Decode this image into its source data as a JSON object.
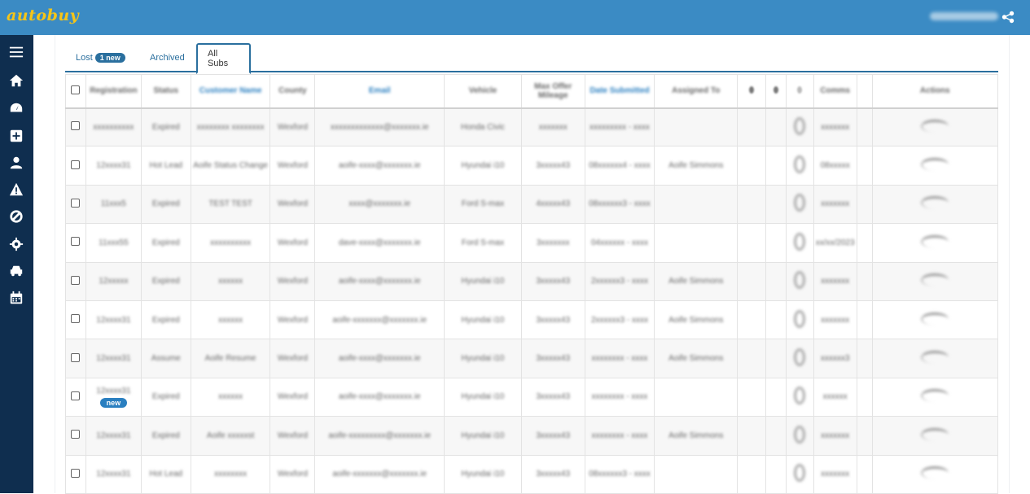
{
  "brand": {
    "logo": "autobuy",
    "user_name": "xxxxxxxxxxxxxx"
  },
  "sidebar": {
    "icons": [
      "menu-icon",
      "home-icon",
      "dashboard-icon",
      "plus-square-icon",
      "user-icon",
      "warning-icon",
      "ban-icon",
      "gear-icon",
      "car-icon",
      "calendar-icon"
    ]
  },
  "tabs": [
    {
      "label": "Lost",
      "badge": "1 new"
    },
    {
      "label": "Archived"
    },
    {
      "label": "All Subs"
    }
  ],
  "table": {
    "headers": [
      "Registration",
      "Status",
      "Customer Name",
      "County",
      "Email",
      "Vehicle",
      "Max Offer Mileage",
      "Date Submitted",
      "Assigned To",
      "",
      "",
      "",
      "Comms",
      "",
      "Actions"
    ],
    "rows": [
      {
        "reg": "xxxxxxxxxx",
        "new": false,
        "status": "Expired",
        "name": "xxxxxxxx xxxxxxxx",
        "county": "Wexford",
        "email": "xxxxxxxxxxxxx@xxxxxxx.ie",
        "vehicle": "Honda Civic",
        "mileage": "xxxxxxx",
        "date": "xxxxxxxxx - xxxx",
        "assigned": "",
        "comms": "xxxxxxx"
      },
      {
        "reg": "12xxxx31",
        "new": false,
        "status": "Hot Lead",
        "name": "Aoife Status Change",
        "county": "Wexford",
        "email": "aoife-xxxx@xxxxxxx.ie",
        "vehicle": "Hyundai i10",
        "mileage": "3xxxxx43",
        "date": "08xxxxxx4 - xxxx",
        "assigned": "Aoife Simmons",
        "comms": "08xxxxx"
      },
      {
        "reg": "11xxx5",
        "new": false,
        "status": "Expired",
        "name": "TEST TEST",
        "county": "Wexford",
        "email": "xxxx@xxxxxxx.ie",
        "vehicle": "Ford S-max",
        "mileage": "4xxxxx43",
        "date": "08xxxxxx3 - xxxx",
        "assigned": "",
        "comms": "xxxxxxx"
      },
      {
        "reg": "11xxx55",
        "new": false,
        "status": "Expired",
        "name": "xxxxxxxxxx",
        "county": "Wexford",
        "email": "dave-xxxx@xxxxxxx.ie",
        "vehicle": "Ford S-max",
        "mileage": "3xxxxxxx",
        "date": "04xxxxxx - xxxx",
        "assigned": "",
        "comms": "xx/xx/2023"
      },
      {
        "reg": "12xxxxx",
        "new": false,
        "status": "Expired",
        "name": "xxxxxx",
        "county": "Wexford",
        "email": "aoife-xxxx@xxxxxxx.ie",
        "vehicle": "Hyundai i10",
        "mileage": "3xxxxx43",
        "date": "2xxxxxx3 - xxxx",
        "assigned": "Aoife Simmons",
        "comms": "xxxxxxx"
      },
      {
        "reg": "12xxxx31",
        "new": false,
        "status": "Expired",
        "name": "xxxxxx",
        "county": "Wexford",
        "email": "aoife-xxxxxxx@xxxxxxx.ie",
        "vehicle": "Hyundai i10",
        "mileage": "3xxxxx43",
        "date": "2xxxxxx3 - xxxx",
        "assigned": "Aoife Simmons",
        "comms": "xxxxxxx"
      },
      {
        "reg": "12xxxx31",
        "new": false,
        "status": "Assume",
        "name": "Aoife Resume",
        "county": "Wexford",
        "email": "aoife-xxxx@xxxxxxx.ie",
        "vehicle": "Hyundai i10",
        "mileage": "3xxxxx43",
        "date": "xxxxxxxx - xxxx",
        "assigned": "Aoife Simmons",
        "comms": "xxxxxx3"
      },
      {
        "reg": "12xxxx31",
        "new": true,
        "status": "Expired",
        "name": "xxxxxx",
        "county": "Wexford",
        "email": "aoife-xxxx@xxxxxxx.ie",
        "vehicle": "Hyundai i10",
        "mileage": "3xxxxx43",
        "date": "xxxxxxxx - xxxx",
        "assigned": "",
        "comms": "xxxxxx"
      },
      {
        "reg": "12xxxx31",
        "new": false,
        "status": "Expired",
        "name": "Aoife xxxxxst",
        "county": "Wexford",
        "email": "aoife-xxxxxxxxx@xxxxxxx.ie",
        "vehicle": "Hyundai i10",
        "mileage": "3xxxxx43",
        "date": "xxxxxxxx - xxxx",
        "assigned": "Aoife Simmons",
        "comms": "xxxxxxx"
      },
      {
        "reg": "12xxxx31",
        "new": false,
        "status": "Hot Lead",
        "name": "xxxxxxxx",
        "county": "Wexford",
        "email": "aoife-xxxxxxx@xxxxxxx.ie",
        "vehicle": "Hyundai i10",
        "mileage": "3xxxxx43",
        "date": "08xxxxxx3 - xxxx",
        "assigned": "",
        "comms": "xxxxxxx"
      }
    ],
    "new_label": "new"
  }
}
